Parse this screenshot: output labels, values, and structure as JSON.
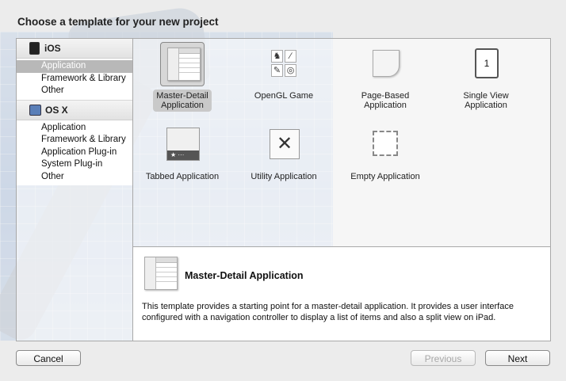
{
  "title": "Choose a template for your new project",
  "sidebar": {
    "groups": [
      {
        "name": "iOS",
        "items": [
          "Application",
          "Framework & Library",
          "Other"
        ],
        "selected_index": 0
      },
      {
        "name": "OS X",
        "items": [
          "Application",
          "Framework & Library",
          "Application Plug-in",
          "System Plug-in",
          "Other"
        ]
      }
    ]
  },
  "templates": [
    {
      "line1": "Master-Detail",
      "line2": "Application",
      "icon": "master-detail-icon",
      "selected": true
    },
    {
      "line1": "OpenGL Game",
      "line2": "",
      "icon": "opengl-game-icon"
    },
    {
      "line1": "Page-Based",
      "line2": "Application",
      "icon": "page-based-icon"
    },
    {
      "line1": "Single View",
      "line2": "Application",
      "icon": "single-view-icon",
      "glyph": "1"
    },
    {
      "line1": "Tabbed Application",
      "line2": "",
      "icon": "tabbed-icon",
      "glyph": "★ ···"
    },
    {
      "line1": "Utility Application",
      "line2": "",
      "icon": "utility-icon"
    },
    {
      "line1": "Empty Application",
      "line2": "",
      "icon": "empty-icon"
    }
  ],
  "detail": {
    "name": "Master-Detail Application",
    "description": "This template provides a starting point for a master-detail application. It provides a user interface configured with a navigation controller to display a list of items and also a split view on iPad."
  },
  "buttons": {
    "cancel": "Cancel",
    "previous": "Previous",
    "next": "Next"
  }
}
